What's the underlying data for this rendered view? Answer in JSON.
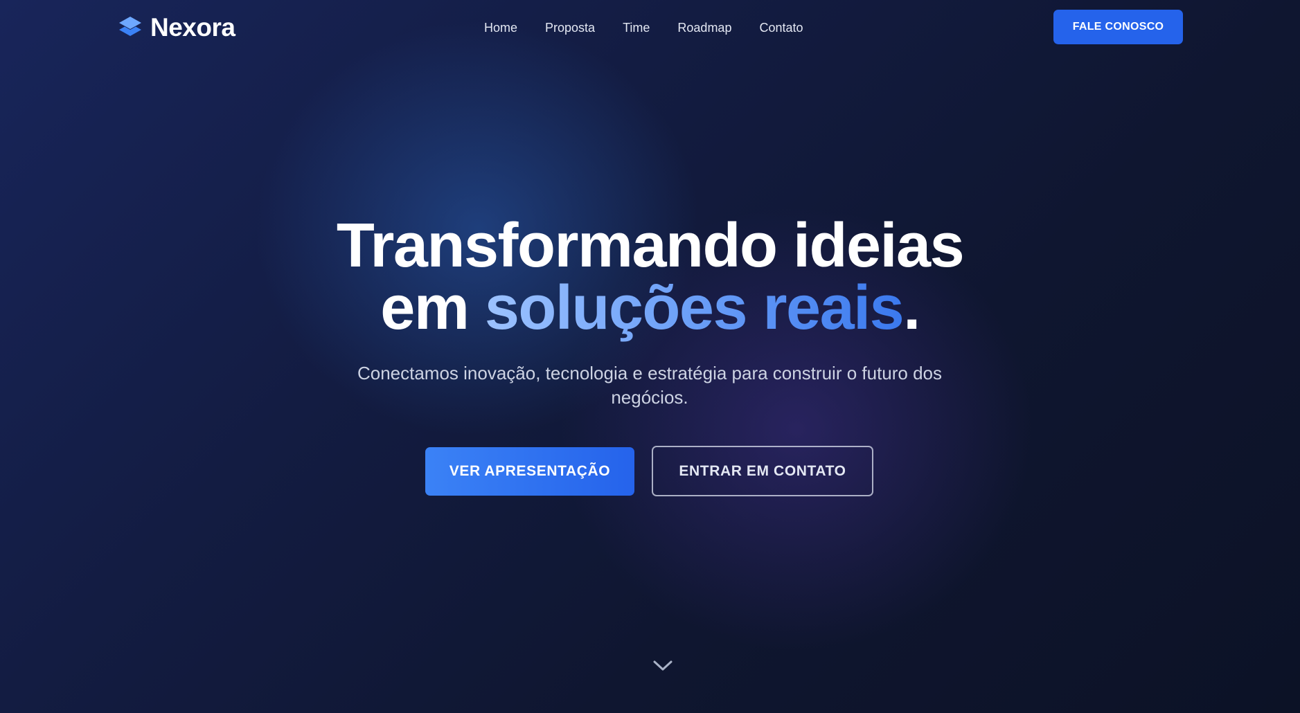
{
  "header": {
    "brand": "Nexora",
    "logo_icon": "stacked-layers-icon",
    "nav": [
      {
        "label": "Home"
      },
      {
        "label": "Proposta"
      },
      {
        "label": "Time"
      },
      {
        "label": "Roadmap"
      },
      {
        "label": "Contato"
      }
    ],
    "cta_label": "FALE CONOSCO"
  },
  "hero": {
    "headline_line1": "Transformando ideias",
    "headline_line2_prefix": "em ",
    "headline_highlight": "soluções reais",
    "headline_suffix": ".",
    "subtitle": "Conectamos inovação, tecnologia e estratégia para construir o futuro dos negócios.",
    "primary_button": "VER APRESENTAÇÃO",
    "secondary_button": "ENTRAR EM CONTATO",
    "scroll_icon": "chevron-down-icon"
  },
  "colors": {
    "accent": "#2563eb",
    "highlight_gradient_start": "#9cc2ff",
    "highlight_gradient_end": "#3b79ee",
    "background_dark": "#0d1326",
    "background_navy": "#18255a"
  }
}
